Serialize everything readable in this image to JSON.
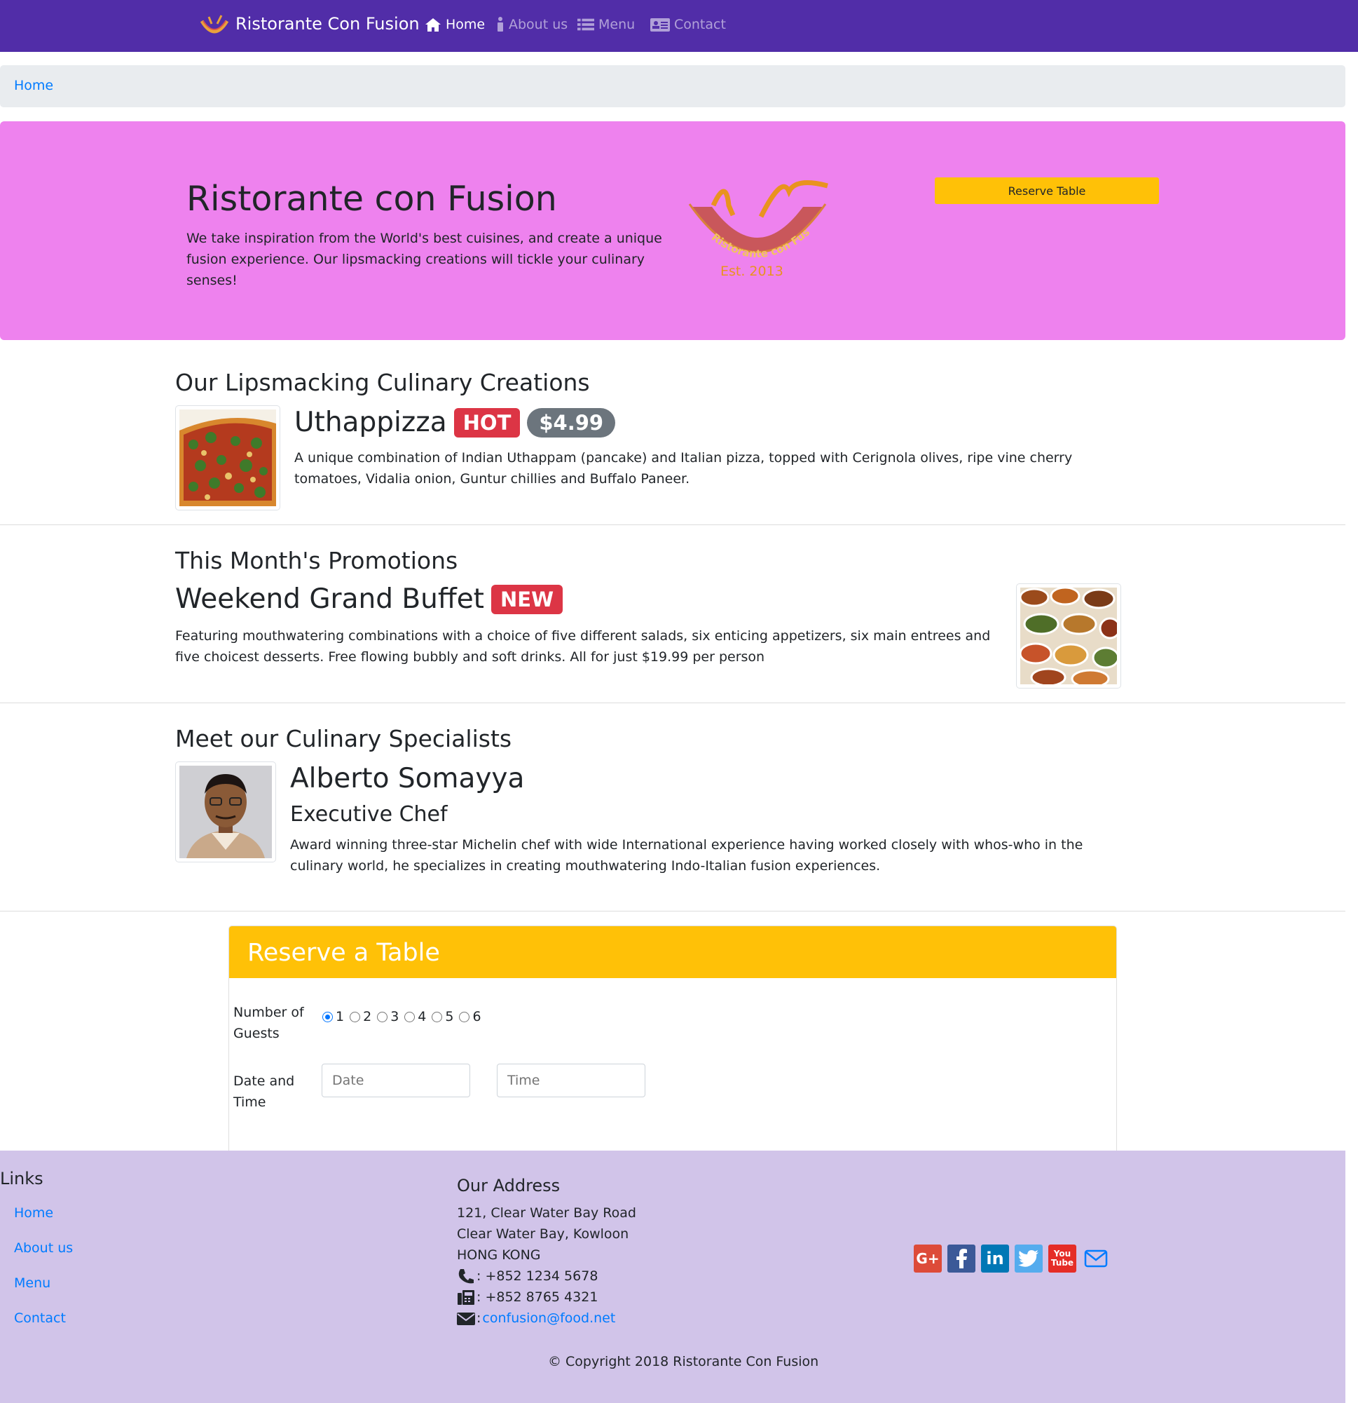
{
  "navbar": {
    "brand": "Ristorante Con Fusion",
    "items": [
      {
        "label": "Home",
        "icon": "home-icon",
        "active": true
      },
      {
        "label": "About us",
        "icon": "info-icon",
        "active": false
      },
      {
        "label": "Menu",
        "icon": "list-icon",
        "active": false
      },
      {
        "label": "Contact",
        "icon": "address-card-icon",
        "active": false
      }
    ]
  },
  "breadcrumb": {
    "label": "Home"
  },
  "jumbotron": {
    "title": "Ristorante con Fusion",
    "text": "We take inspiration from the World's best cuisines, and create a unique fusion experience. Our lipsmacking creations will tickle your culinary senses!",
    "logo_text": "Ristorante con Fusion",
    "logo_est": "Est. 2013",
    "button": "Reserve Table"
  },
  "dish": {
    "section_title": "Our Lipsmacking Culinary Creations",
    "name": "Uthappizza",
    "badge": "HOT",
    "price": "$4.99",
    "description": "A unique combination of Indian Uthappam (pancake) and Italian pizza, topped with Cerignola olives, ripe vine cherry tomatoes, Vidalia onion, Guntur chillies and Buffalo Paneer."
  },
  "promotion": {
    "section_title": "This Month's Promotions",
    "name": "Weekend Grand Buffet",
    "badge": "NEW",
    "description": "Featuring mouthwatering combinations with a choice of five different salads, six enticing appetizers, six main entrees and five choicest desserts. Free flowing bubbly and soft drinks. All for just $19.99 per person"
  },
  "leader": {
    "section_title": "Meet our Culinary Specialists",
    "name": "Alberto Somayya",
    "designation": "Executive Chef",
    "description": "Award winning three-star Michelin chef with wide International experience having worked closely with whos-who in the culinary world, he specializes in creating mouthwatering Indo-Italian fusion experiences."
  },
  "reservation": {
    "title": "Reserve a Table",
    "guests_label": "Number of Guests",
    "guest_options": [
      "1",
      "2",
      "3",
      "4",
      "5",
      "6"
    ],
    "selected_guests": "1",
    "datetime_label": "Date and Time",
    "date_placeholder": "Date",
    "time_placeholder": "Time"
  },
  "footer": {
    "links_title": "Links",
    "links": [
      "Home",
      "About us",
      "Menu",
      "Contact"
    ],
    "address_title": "Our Address",
    "address_lines": [
      "121, Clear Water Bay Road",
      "Clear Water Bay, Kowloon",
      "HONG KONG"
    ],
    "phone": ": +852 1234 5678",
    "fax": ": +852 8765 4321",
    "email_prefix": ":",
    "email": "confusion@food.net",
    "social": [
      "google-plus-icon",
      "facebook-icon",
      "linkedin-icon",
      "twitter-icon",
      "youtube-icon",
      "envelope-icon"
    ],
    "copyright": "© Copyright 2018 Ristorante Con Fusion"
  },
  "colors": {
    "navbar": "#512da8",
    "jumbotron": "#ee82ee",
    "warning": "#ffc107",
    "danger": "#dc3545",
    "secondary": "#6c757d",
    "footer": "#d1c4e9",
    "link": "#007bff"
  }
}
